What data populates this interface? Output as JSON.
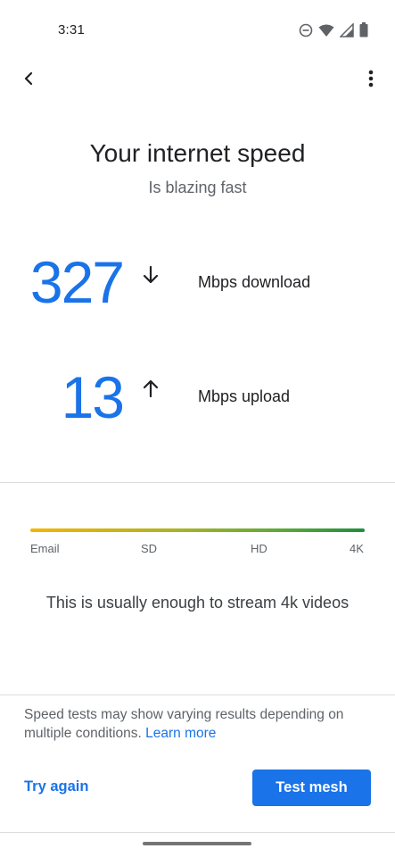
{
  "status_bar": {
    "time": "3:31",
    "icons": [
      "do-not-disturb-icon",
      "wifi-icon",
      "cellular-signal-icon",
      "battery-icon"
    ]
  },
  "app_bar": {
    "back_icon": "back-arrow-icon",
    "menu_icon": "more-vert-icon"
  },
  "header": {
    "title": "Your internet speed",
    "subtitle": "Is blazing fast"
  },
  "download": {
    "value": "327",
    "label": "Mbps download",
    "icon": "arrow-down-icon"
  },
  "upload": {
    "value": "13",
    "label": "Mbps upload",
    "icon": "arrow-up-icon"
  },
  "gauge": {
    "labels": [
      "Email",
      "SD",
      "HD",
      "4K"
    ],
    "level": 1.0,
    "colors": [
      "#f6b400",
      "#1e8e3e"
    ]
  },
  "stream_text": "This is usually enough to stream 4k videos",
  "disclaimer": {
    "text": "Speed tests may show varying results depending on multiple conditions.",
    "link": "Learn more"
  },
  "actions": {
    "try_again": "Try again",
    "test_mesh": "Test mesh"
  },
  "colors": {
    "accent": "#1a73e8",
    "text_primary": "#202124",
    "text_secondary": "#5f6368"
  }
}
